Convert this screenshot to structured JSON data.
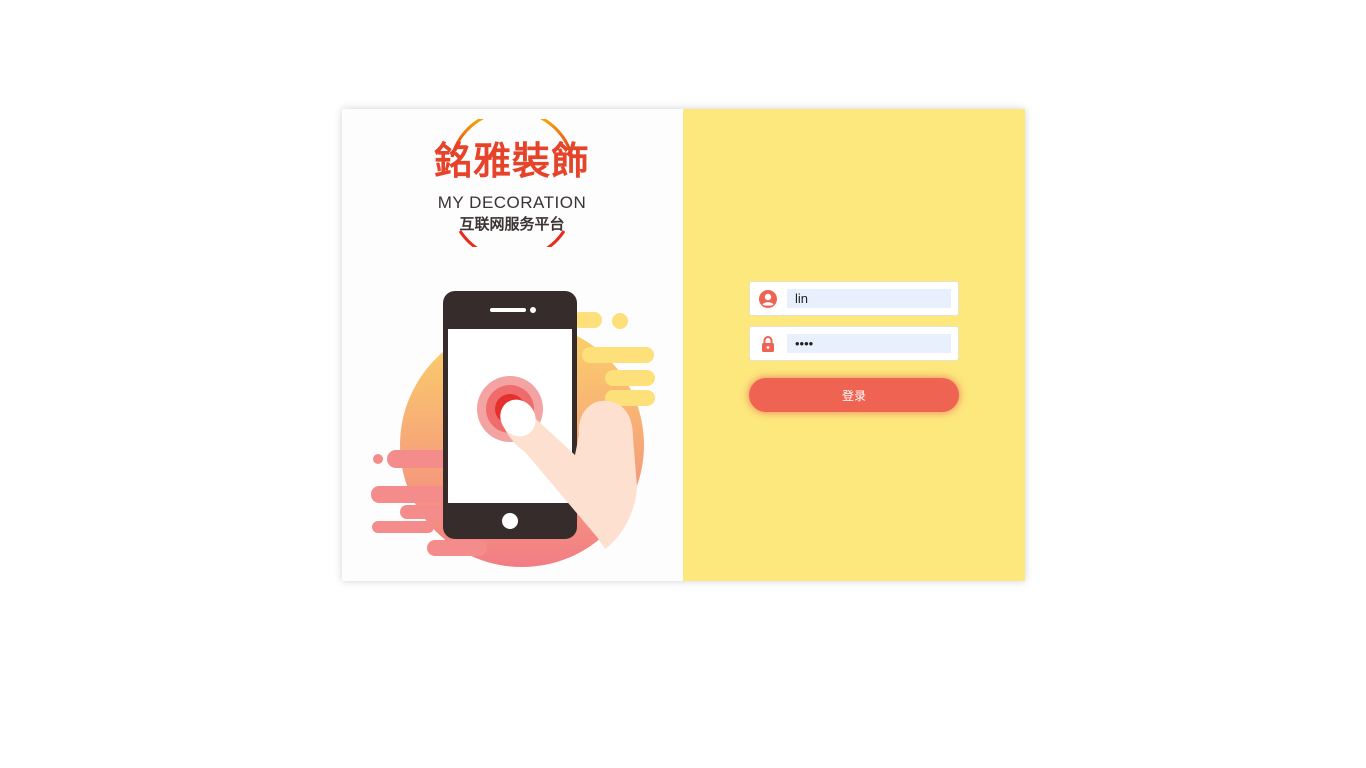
{
  "colors": {
    "accent": "#ef6353",
    "panel_right": "#fde87e",
    "logo_red": "#e6442a",
    "logo_ring": "#f5b400",
    "phone_body": "#362c2b"
  },
  "logo": {
    "name_cn": "銘雅裝飾",
    "name_en": "MY DECORATION",
    "subtitle": "互联网服务平台"
  },
  "login_form": {
    "username": {
      "icon": "user-circle-icon",
      "value": "lin"
    },
    "password": {
      "icon": "lock-icon",
      "value": "1234"
    },
    "submit_label": "登录"
  },
  "illustration": {
    "icon": "phone-tap-illustration"
  }
}
